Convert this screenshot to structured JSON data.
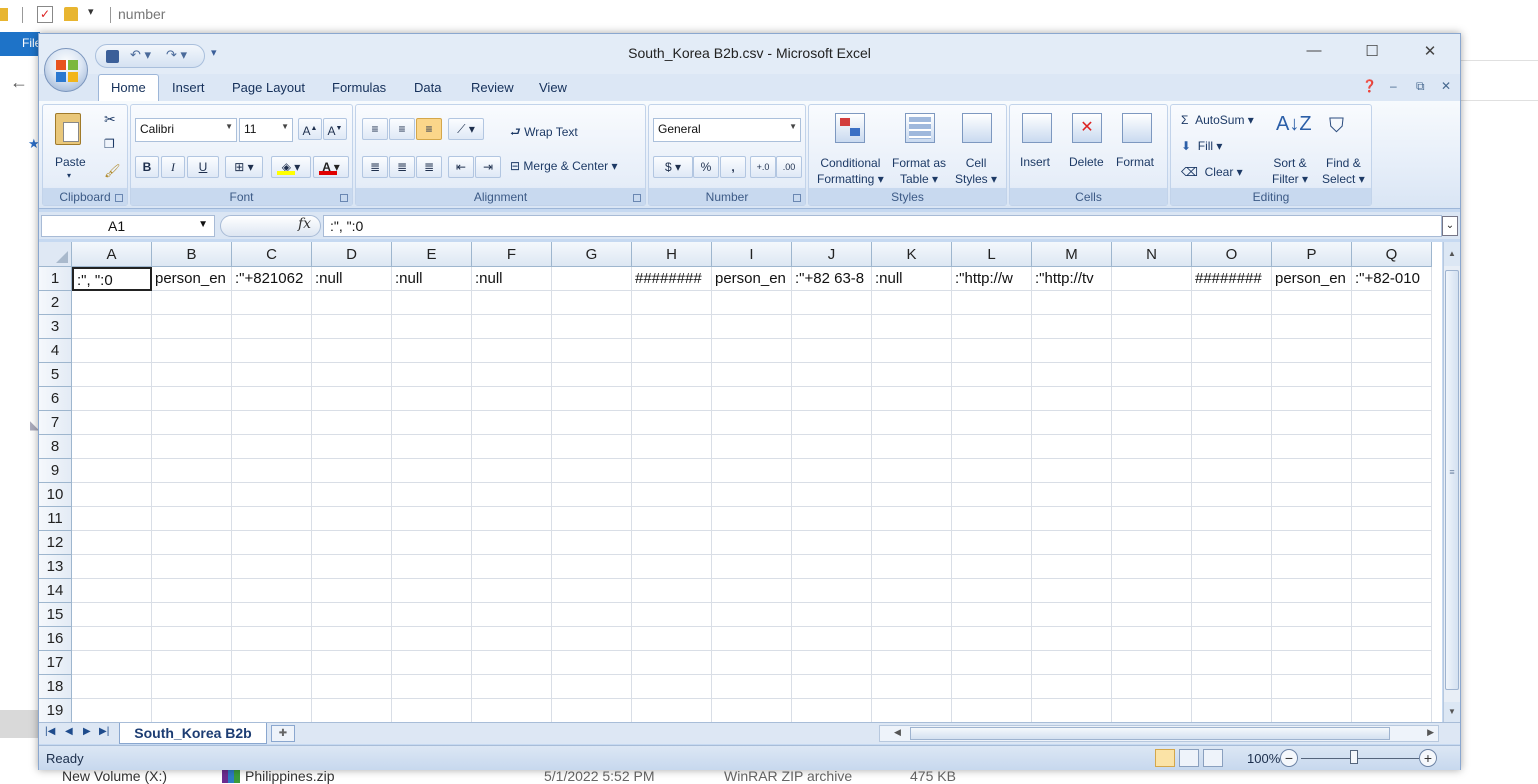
{
  "background": {
    "explorer_title": "number",
    "file_tab": "File",
    "bottom_row": {
      "name": "Philippines.zip",
      "date": "5/1/2022 5:52 PM",
      "type": "WinRAR ZIP archive",
      "size": "475 KB",
      "left_label": "New Volume (X:)"
    }
  },
  "window": {
    "title": "South_Korea B2b.csv - Microsoft Excel",
    "minimize": "—",
    "maximize": "☐",
    "close": "✕"
  },
  "ribbon": {
    "tabs": [
      "Home",
      "Insert",
      "Page Layout",
      "Formulas",
      "Data",
      "Review",
      "View"
    ],
    "clipboard": {
      "label": "Clipboard",
      "paste": "Paste"
    },
    "font": {
      "label": "Font",
      "name": "Calibri",
      "size": "11",
      "bold": "B",
      "italic": "I",
      "underline": "U"
    },
    "alignment": {
      "label": "Alignment",
      "wrap": "Wrap Text",
      "merge": "Merge & Center"
    },
    "number": {
      "label": "Number",
      "format": "General",
      "currency": "$",
      "percent": "%",
      "comma": ",",
      "inc_dec": "+.0 .00",
      "dec_dec": ".00 →.0"
    },
    "styles": {
      "label": "Styles",
      "conditional": [
        "Conditional",
        "Formatting"
      ],
      "format_table": [
        "Format as",
        "Table"
      ],
      "cell_styles": [
        "Cell",
        "Styles"
      ]
    },
    "cells": {
      "label": "Cells",
      "insert": "Insert",
      "delete": "Delete",
      "format": "Format"
    },
    "editing": {
      "label": "Editing",
      "autosum": "AutoSum",
      "fill": "Fill",
      "clear": "Clear",
      "sort": [
        "Sort &",
        "Filter"
      ],
      "find": [
        "Find &",
        "Select"
      ]
    }
  },
  "formula_bar": {
    "name_box": "A1",
    "fx": "fx",
    "content": ":\", \":0"
  },
  "grid": {
    "columns": [
      "A",
      "B",
      "C",
      "D",
      "E",
      "F",
      "G",
      "H",
      "I",
      "J",
      "K",
      "L",
      "M",
      "N",
      "O",
      "P",
      "Q"
    ],
    "rows": [
      "1",
      "2",
      "3",
      "4",
      "5",
      "6",
      "7",
      "8",
      "9",
      "10",
      "11",
      "12",
      "13",
      "14",
      "15",
      "16",
      "17",
      "18",
      "19"
    ],
    "row1": [
      ":\", \":0",
      "person_en",
      ":\"+821062",
      ":null",
      ":null",
      ":null",
      "",
      "########",
      "person_en",
      ":\"+82 63-8",
      ":null",
      ":\"http://w",
      ":\"http://tv",
      "",
      "########",
      "person_en",
      ":\"+82-010"
    ]
  },
  "sheet": {
    "tab": "South_Korea B2b"
  },
  "status": {
    "ready": "Ready",
    "zoom": "100%"
  }
}
